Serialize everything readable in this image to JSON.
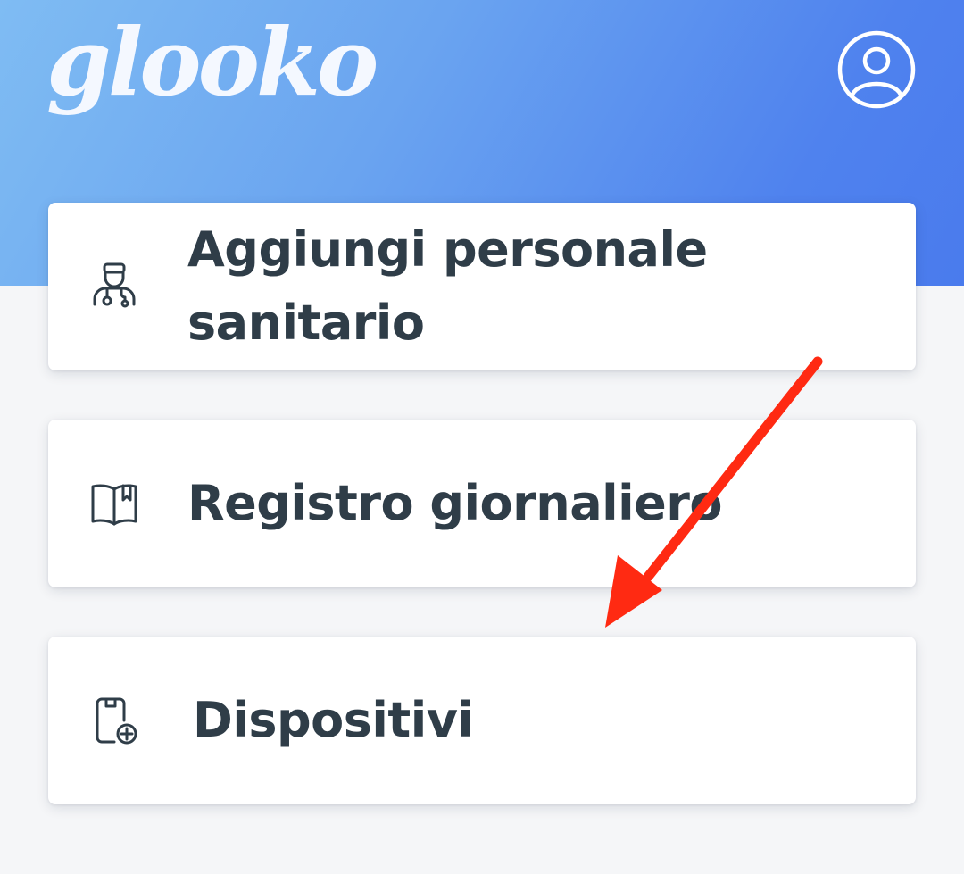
{
  "header": {
    "logo_text": "glooko",
    "profile_icon": "user-circle-icon"
  },
  "menu": {
    "items": [
      {
        "label": "Aggiungi personale sanitario",
        "icon": "doctor-icon"
      },
      {
        "label": "Registro giornaliero",
        "icon": "book-icon"
      },
      {
        "label": "Dispositivi",
        "icon": "device-add-icon"
      }
    ]
  },
  "colors": {
    "header_gradient_start": "#7fbcf3",
    "header_gradient_end": "#4a7bed",
    "text": "#2f3d48",
    "arrow": "#ff2a12",
    "background": "#f5f6f8"
  }
}
